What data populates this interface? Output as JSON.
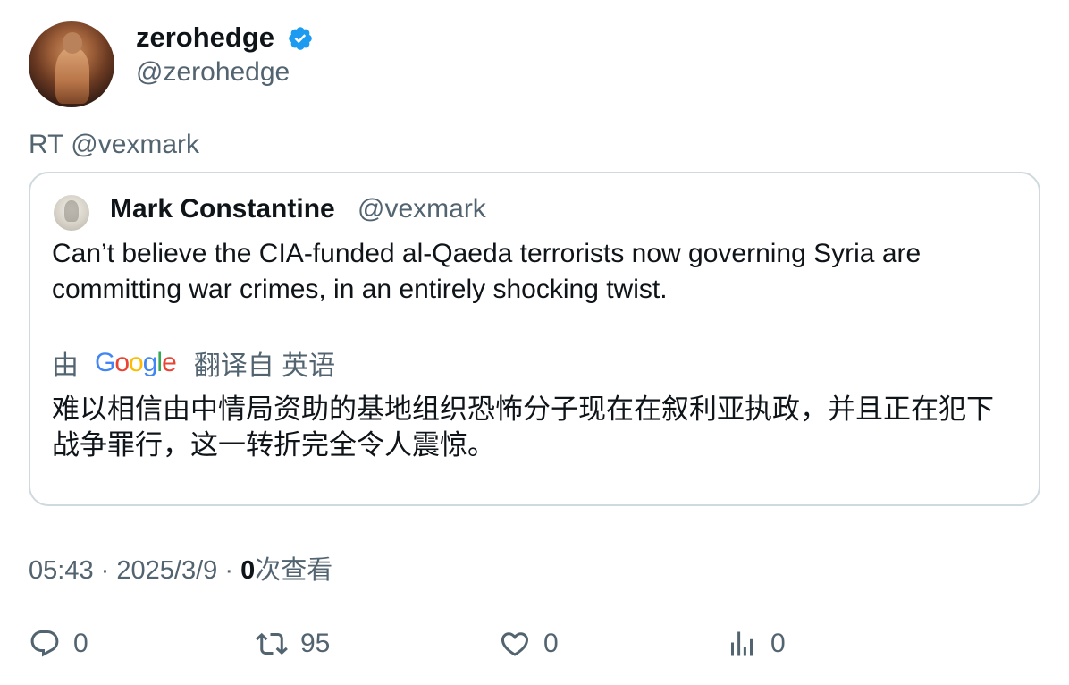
{
  "author": {
    "display_name": "zerohedge",
    "handle": "@zerohedge",
    "verified": true,
    "verified_color": "#1d9bf0"
  },
  "retweet_line": "RT @vexmark",
  "quote": {
    "display_name": "Mark Constantine",
    "handle": "@vexmark",
    "text": "Can’t believe the CIA-funded al-Qaeda terrorists now governing Syria are committing war crimes, in an entirely shocking twist.",
    "translation": {
      "by_label": "由",
      "provider": "Google",
      "from_label": "翻译自 英语",
      "text": "难以相信由中情局资助的基地组织恐怖分子现在在叙利亚执政，并且正在犯下战争罪行，这一转折完全令人震惊。"
    }
  },
  "meta": {
    "time": "05:43",
    "separator": "·",
    "date": "2025/3/9",
    "views_count": "0",
    "views_label": "次查看"
  },
  "actions": {
    "reply_count": "0",
    "retweet_count": "95",
    "like_count": "0",
    "views_count": "0"
  }
}
